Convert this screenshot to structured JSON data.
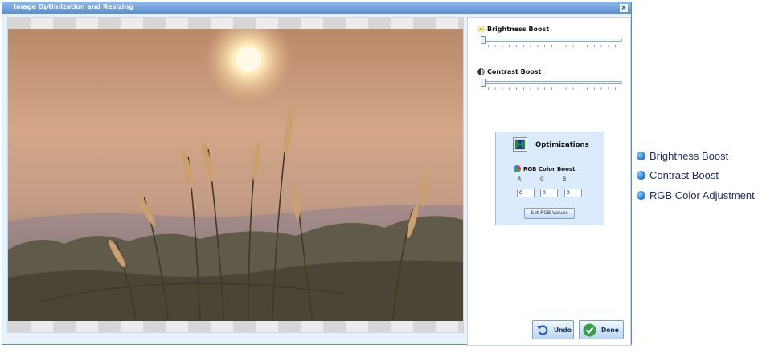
{
  "window": {
    "title": "Image Optimization and Resizing",
    "close_glyph": "×"
  },
  "image_pane": {
    "photo_icon": "sunset-grass-photo"
  },
  "controls": {
    "brightness": {
      "label": "Brightness Boost",
      "value": 0,
      "icon": "sun-icon"
    },
    "contrast": {
      "label": "Contrast Boost",
      "value": 0,
      "icon": "contrast-icon"
    }
  },
  "optimizations": {
    "title": "Optimizations",
    "rgb_label": "RGB Color Boost",
    "channels": [
      "R",
      "G",
      "B"
    ],
    "values": [
      "0",
      "0",
      "0"
    ],
    "set_button": "Set RGB Values"
  },
  "buttons": {
    "undo": "Undo",
    "done": "Done"
  },
  "legend": [
    "Brightness Boost",
    "Contrast Boost",
    "RGB Color Adjustment"
  ],
  "colors": {
    "accent": "#5a8fd0",
    "panel_bg": "#dcebfb",
    "legend_text": "#1f2f66"
  }
}
